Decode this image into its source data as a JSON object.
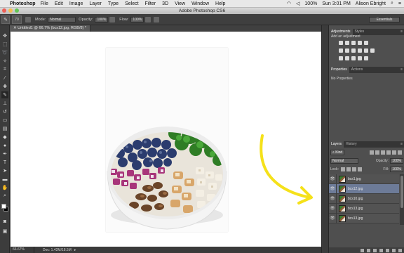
{
  "menubar": {
    "app_name": "Photoshop",
    "items": [
      "File",
      "Edit",
      "Image",
      "Layer",
      "Type",
      "Select",
      "Filter",
      "3D",
      "View",
      "Window",
      "Help"
    ],
    "clock": "Sun 3:01 PM",
    "user": "Alison Ebright",
    "battery": "100%"
  },
  "window": {
    "title": "Adobe Photoshop CS6"
  },
  "options_bar": {
    "brush_size": "70",
    "mode_label": "Mode:",
    "mode_value": "Normal",
    "opacity_label": "Opacity:",
    "opacity_value": "100%",
    "flow_label": "Flow:",
    "flow_value": "100%",
    "workspace": "Essentials"
  },
  "document": {
    "tab_title": "Untitled1 @ 66.7% (bcs12.jpg, RGB/8) *",
    "zoom": "66.67%",
    "doc_info": "Doc: 1.42M/18.5M"
  },
  "panels": {
    "adjustments": {
      "tabs": [
        "Adjustments",
        "Styles"
      ],
      "heading": "Add an adjustment"
    },
    "properties": {
      "tabs": [
        "Properties",
        "Actions"
      ],
      "empty_text": "No Properties"
    },
    "layers": {
      "tabs": [
        "Layers",
        "History"
      ],
      "kind_label": "Kind",
      "blend_mode": "Normal",
      "opacity_label": "Opacity:",
      "opacity_value": "100%",
      "lock_label": "Lock:",
      "fill_label": "Fill:",
      "fill_value": "100%",
      "items": [
        {
          "name": "bcs1.jpg",
          "selected": false
        },
        {
          "name": "bcs12.jpg",
          "selected": true
        },
        {
          "name": "bcs10.jpg",
          "selected": false
        },
        {
          "name": "bcs13.jpg",
          "selected": false
        },
        {
          "name": "bcs13.jpg",
          "selected": false
        }
      ]
    }
  },
  "colors": {
    "selected_layer": "#6d7b98",
    "annotation_arrow": "#f5e11a"
  }
}
